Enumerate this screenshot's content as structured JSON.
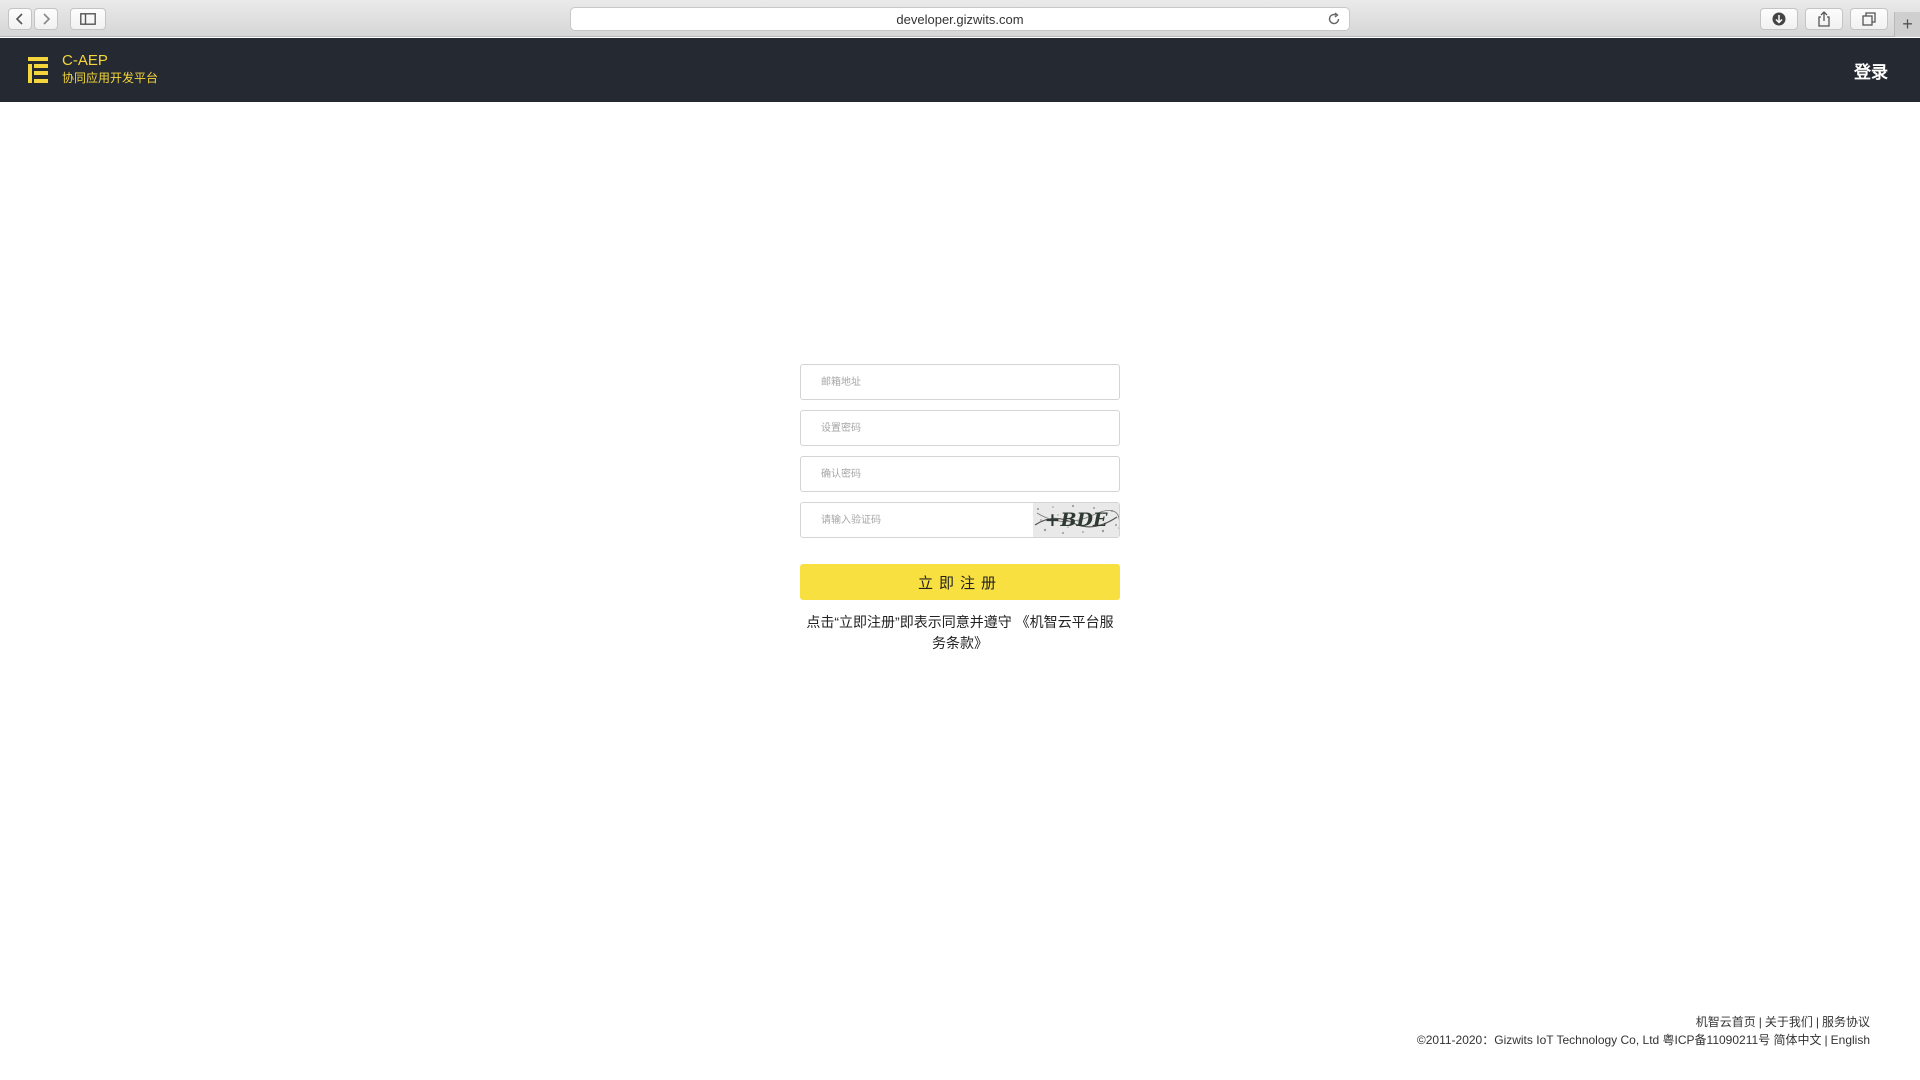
{
  "browser": {
    "url": "developer.gizwits.com",
    "icons": [
      "back-icon",
      "forward-icon",
      "sidebar-icon",
      "reload-icon",
      "download-icon",
      "share-icon",
      "tabs-icon",
      "plus-icon"
    ],
    "new_tab": "+"
  },
  "header": {
    "brand_name": "C-AEP",
    "brand_sub": "协同应用开发平台",
    "login_label": "登录",
    "accent_color": "#f4d53c",
    "background_color": "#252a32"
  },
  "form": {
    "email_placeholder": "邮箱地址",
    "password_placeholder": "设置密码",
    "confirm_placeholder": "确认密码",
    "captcha_placeholder": "请输入验证码",
    "captcha_text": "+BDE",
    "submit_label": "立即注册",
    "submit_color": "#f8e040",
    "terms_prefix": "点击“立即注册”即表示同意并遵守",
    "terms_link": "《机智云平台服务条款》"
  },
  "footer": {
    "links": [
      "机智云首页",
      "关于我们",
      "服务协议"
    ],
    "copyright": "©2011-2020：Gizwits IoT Technology Co, Ltd 粤ICP备11090211号",
    "lang_zh": "简体中文",
    "lang_en": "English"
  }
}
